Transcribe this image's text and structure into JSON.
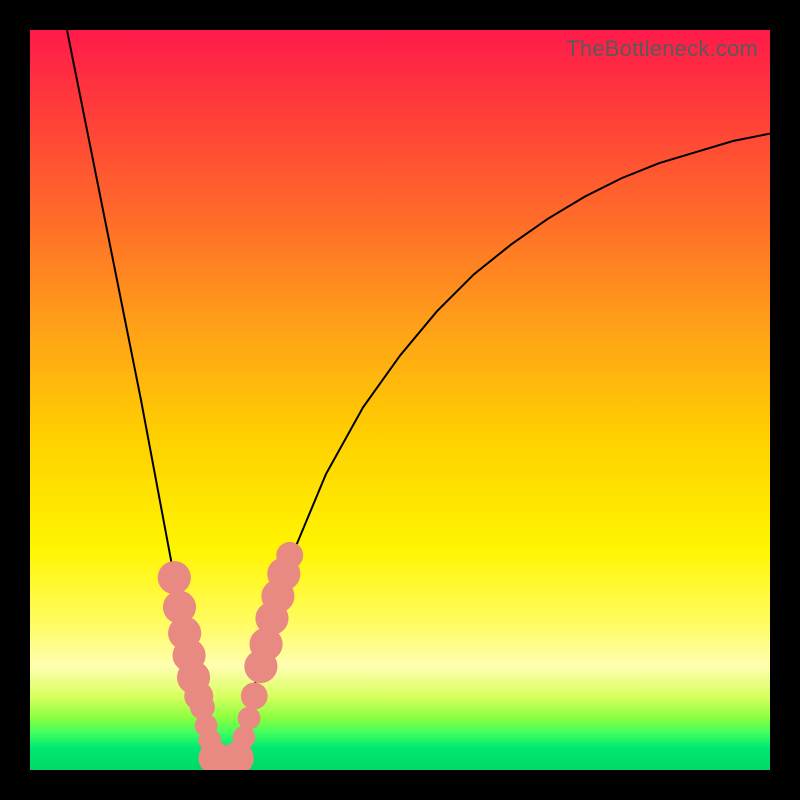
{
  "watermark": "TheBottleneck.com",
  "colors": {
    "frame_bg": "#000000",
    "curve": "#000000",
    "marker": "#e88a82",
    "gradient_top": "#ff1a4a",
    "gradient_bottom": "#00d868"
  },
  "chart_data": {
    "type": "line",
    "title": "",
    "xlabel": "",
    "ylabel": "",
    "xlim": [
      0,
      100
    ],
    "ylim": [
      0,
      100
    ],
    "curve_left": {
      "x": [
        5,
        7,
        9,
        11,
        13,
        15,
        16.5,
        18,
        19.5,
        21,
        22,
        23,
        24,
        25,
        26
      ],
      "y": [
        100,
        90,
        80,
        70,
        60,
        50,
        42,
        34,
        26,
        18,
        12,
        8,
        4,
        1.5,
        0
      ]
    },
    "curve_right": {
      "x": [
        26,
        27,
        28,
        30,
        32,
        35,
        40,
        45,
        50,
        55,
        60,
        65,
        70,
        75,
        80,
        85,
        90,
        95,
        100
      ],
      "y": [
        0,
        1.5,
        4,
        10,
        18,
        28,
        40,
        49,
        56,
        62,
        67,
        71,
        74.5,
        77.5,
        80,
        82,
        83.5,
        85,
        86
      ]
    },
    "markers": [
      {
        "x": 19.5,
        "y": 26,
        "r": 1.6
      },
      {
        "x": 20.2,
        "y": 22,
        "r": 1.6
      },
      {
        "x": 20.9,
        "y": 18.5,
        "r": 1.6
      },
      {
        "x": 21.5,
        "y": 15.5,
        "r": 1.6
      },
      {
        "x": 22.1,
        "y": 12.5,
        "r": 1.6
      },
      {
        "x": 22.8,
        "y": 10,
        "r": 1.4
      },
      {
        "x": 23.3,
        "y": 8.5,
        "r": 1.2
      },
      {
        "x": 23.8,
        "y": 6,
        "r": 1.1
      },
      {
        "x": 24.3,
        "y": 4,
        "r": 1.1
      },
      {
        "x": 25.0,
        "y": 1.6,
        "r": 1.6
      },
      {
        "x": 26.0,
        "y": 0.5,
        "r": 1.6
      },
      {
        "x": 27.0,
        "y": 0.5,
        "r": 1.6
      },
      {
        "x": 28.0,
        "y": 1.6,
        "r": 1.6
      },
      {
        "x": 28.9,
        "y": 4.4,
        "r": 1.1
      },
      {
        "x": 29.6,
        "y": 7,
        "r": 1.1
      },
      {
        "x": 30.3,
        "y": 10,
        "r": 1.3
      },
      {
        "x": 31.2,
        "y": 14,
        "r": 1.6
      },
      {
        "x": 31.9,
        "y": 17,
        "r": 1.6
      },
      {
        "x": 32.7,
        "y": 20.5,
        "r": 1.6
      },
      {
        "x": 33.5,
        "y": 23.5,
        "r": 1.6
      },
      {
        "x": 34.3,
        "y": 26.5,
        "r": 1.6
      },
      {
        "x": 35.1,
        "y": 29,
        "r": 1.3
      }
    ]
  }
}
